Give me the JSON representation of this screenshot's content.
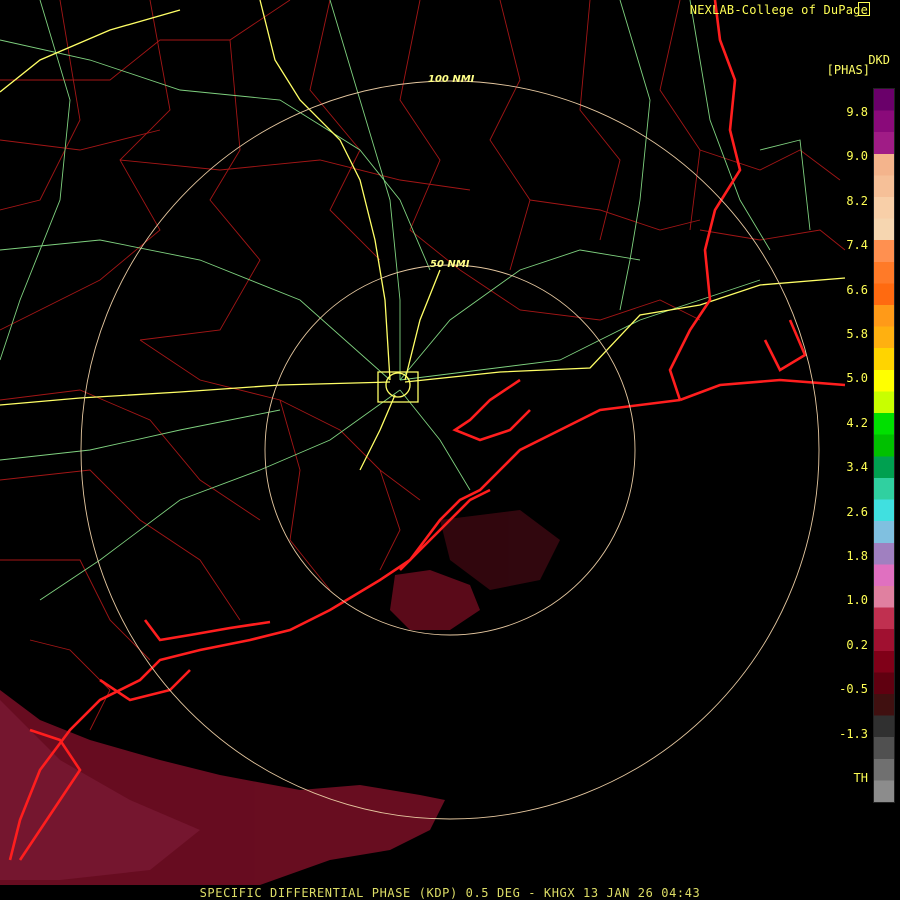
{
  "header": {
    "credit": "NEXLAB-College of DuPage",
    "product_code": "DKD",
    "units": "[PHAS]"
  },
  "rings": [
    {
      "label": "100 NMI"
    },
    {
      "label": "50 NMI"
    }
  ],
  "legend": {
    "ticks": [
      "9.8",
      "9.0",
      "8.2",
      "7.4",
      "6.6",
      "5.8",
      "5.0",
      "4.2",
      "3.4",
      "2.6",
      "1.8",
      "1.0",
      "0.2",
      "-0.5",
      "-1.3",
      "TH"
    ],
    "colors": [
      "#6a006a",
      "#8a0a7a",
      "#a01c86",
      "#f4b48c",
      "#f6c098",
      "#f8cfa8",
      "#f6d6b0",
      "#ff9050",
      "#ff7a28",
      "#ff6a10",
      "#ff9a18",
      "#ffb010",
      "#ffd400",
      "#ffff00",
      "#c8ff00",
      "#00e000",
      "#00c000",
      "#00a050",
      "#30d0a0",
      "#40e0e0",
      "#80c0e0",
      "#a080c0",
      "#e070c0",
      "#e080a0",
      "#c03050",
      "#a01030",
      "#800018",
      "#600010",
      "#401010",
      "#303030",
      "#505050",
      "#707070",
      "#8c8c8c"
    ]
  },
  "footer": {
    "text": "SPECIFIC DIFFERENTIAL PHASE (KDP) 0.5 DEG - KHGX 13 JAN 26 04:43"
  },
  "map_colors": {
    "background": "#000000",
    "county": "#a31616",
    "state_border": "#ff1e1e",
    "highway": "#ffff66",
    "road": "#7fd17f",
    "ring": "#e6c8a0",
    "echo": "#5c0a14"
  }
}
